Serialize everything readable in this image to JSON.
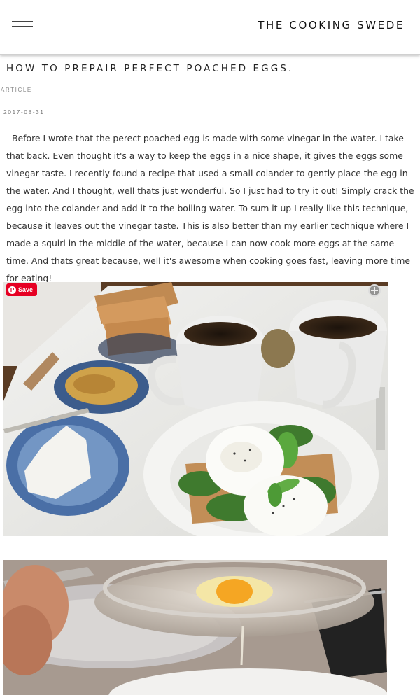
{
  "header": {
    "site_title": "THE COOKING SWEDE",
    "menu_icon": "hamburger-menu-icon"
  },
  "article": {
    "title": "HOW TO PREPAIR PERFECT POACHED EGGS.",
    "category": "ARTICLE",
    "date": "2017-08-31",
    "body": "Before I wrote that the perect poached egg is made with some vinegar in the water. I take that back. Even thought it's a way to keep the eggs in a nice shape, it gives the eggs some vinegar taste. I recently found a recipe that used a small colander to gently place the egg in the water. And I thought, well thats just wonderful. So I just had to try it out! Simply crack the egg into the colander and add it to the boiling water. To sum it up I really like this technique, because it leaves out the vinegar taste. This is also better than my earlier technique where I made a squirl in the middle of the water, because I can now cook more eggs at the same time. And thats great because, well it's awesome when cooking goes fast, leaving more time for eating!"
  },
  "images": {
    "save_label": "Save",
    "pin_icon": "pinterest-icon",
    "zoom_icon": "zoom-plus-icon"
  },
  "colors": {
    "pinterest_red": "#e60023"
  }
}
